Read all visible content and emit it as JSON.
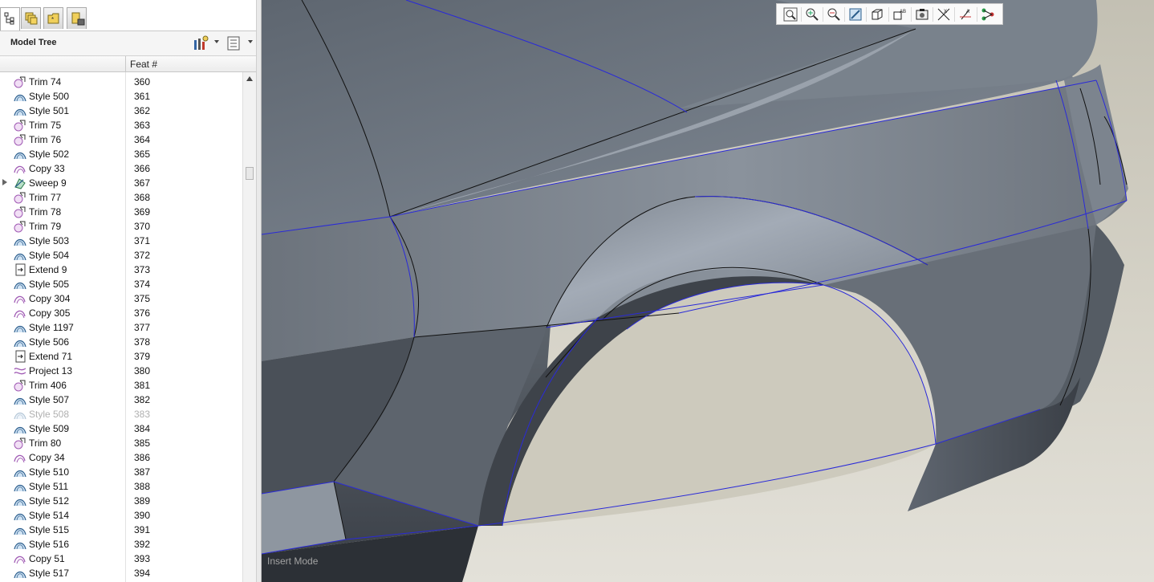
{
  "model_tree": {
    "title": "Model Tree",
    "columns": {
      "feat": "Feat #"
    },
    "rows": [
      {
        "name": "Trim 74",
        "feat": "360",
        "icon": "trim-icon"
      },
      {
        "name": "Style 500",
        "feat": "361",
        "icon": "style-icon"
      },
      {
        "name": "Style 501",
        "feat": "362",
        "icon": "style-icon"
      },
      {
        "name": "Trim 75",
        "feat": "363",
        "icon": "trim-icon"
      },
      {
        "name": "Trim 76",
        "feat": "364",
        "icon": "trim-icon"
      },
      {
        "name": "Style 502",
        "feat": "365",
        "icon": "style-icon"
      },
      {
        "name": "Copy 33",
        "feat": "366",
        "icon": "copy-icon"
      },
      {
        "name": "Sweep 9",
        "feat": "367",
        "icon": "sweep-icon",
        "expandable": true
      },
      {
        "name": "Trim 77",
        "feat": "368",
        "icon": "trim-icon"
      },
      {
        "name": "Trim 78",
        "feat": "369",
        "icon": "trim-icon"
      },
      {
        "name": "Trim 79",
        "feat": "370",
        "icon": "trim-icon"
      },
      {
        "name": "Style 503",
        "feat": "371",
        "icon": "style-icon"
      },
      {
        "name": "Style 504",
        "feat": "372",
        "icon": "style-icon"
      },
      {
        "name": "Extend 9",
        "feat": "373",
        "icon": "extend-icon"
      },
      {
        "name": "Style 505",
        "feat": "374",
        "icon": "style-icon"
      },
      {
        "name": "Copy 304",
        "feat": "375",
        "icon": "copy-icon"
      },
      {
        "name": "Copy 305",
        "feat": "376",
        "icon": "copy-icon"
      },
      {
        "name": "Style 1197",
        "feat": "377",
        "icon": "style-icon"
      },
      {
        "name": "Style 506",
        "feat": "378",
        "icon": "style-icon"
      },
      {
        "name": "Extend 71",
        "feat": "379",
        "icon": "extend-icon"
      },
      {
        "name": "Project 13",
        "feat": "380",
        "icon": "project-icon"
      },
      {
        "name": "Trim 406",
        "feat": "381",
        "icon": "trim-icon"
      },
      {
        "name": "Style 507",
        "feat": "382",
        "icon": "style-icon"
      },
      {
        "name": "Style 508",
        "feat": "383",
        "icon": "style-icon",
        "suppressed": true
      },
      {
        "name": "Style 509",
        "feat": "384",
        "icon": "style-icon"
      },
      {
        "name": "Trim 80",
        "feat": "385",
        "icon": "trim-icon"
      },
      {
        "name": "Copy 34",
        "feat": "386",
        "icon": "copy-icon"
      },
      {
        "name": "Style 510",
        "feat": "387",
        "icon": "style-icon"
      },
      {
        "name": "Style 511",
        "feat": "388",
        "icon": "style-icon"
      },
      {
        "name": "Style 512",
        "feat": "389",
        "icon": "style-icon"
      },
      {
        "name": "Style 514",
        "feat": "390",
        "icon": "style-icon"
      },
      {
        "name": "Style 515",
        "feat": "391",
        "icon": "style-icon"
      },
      {
        "name": "Style 516",
        "feat": "392",
        "icon": "style-icon"
      },
      {
        "name": "Copy 51",
        "feat": "393",
        "icon": "copy-icon"
      },
      {
        "name": "Style 517",
        "feat": "394",
        "icon": "style-icon"
      }
    ]
  },
  "viewport": {
    "mode_label": "Insert Mode",
    "toolbar": [
      "zoom-fit-icon",
      "zoom-in-icon",
      "zoom-out-icon",
      "repaint-icon",
      "display-style-icon",
      "saved-views-icon",
      "view-manager-icon",
      "datum-planes-icon",
      "datum-axes-icon",
      "datum-points-icon"
    ]
  },
  "colors": {
    "surface": "#6e7680",
    "edge_blue": "#2a2ad8",
    "background": "#d2cfc4",
    "accent_purple": "#a05ab4"
  }
}
